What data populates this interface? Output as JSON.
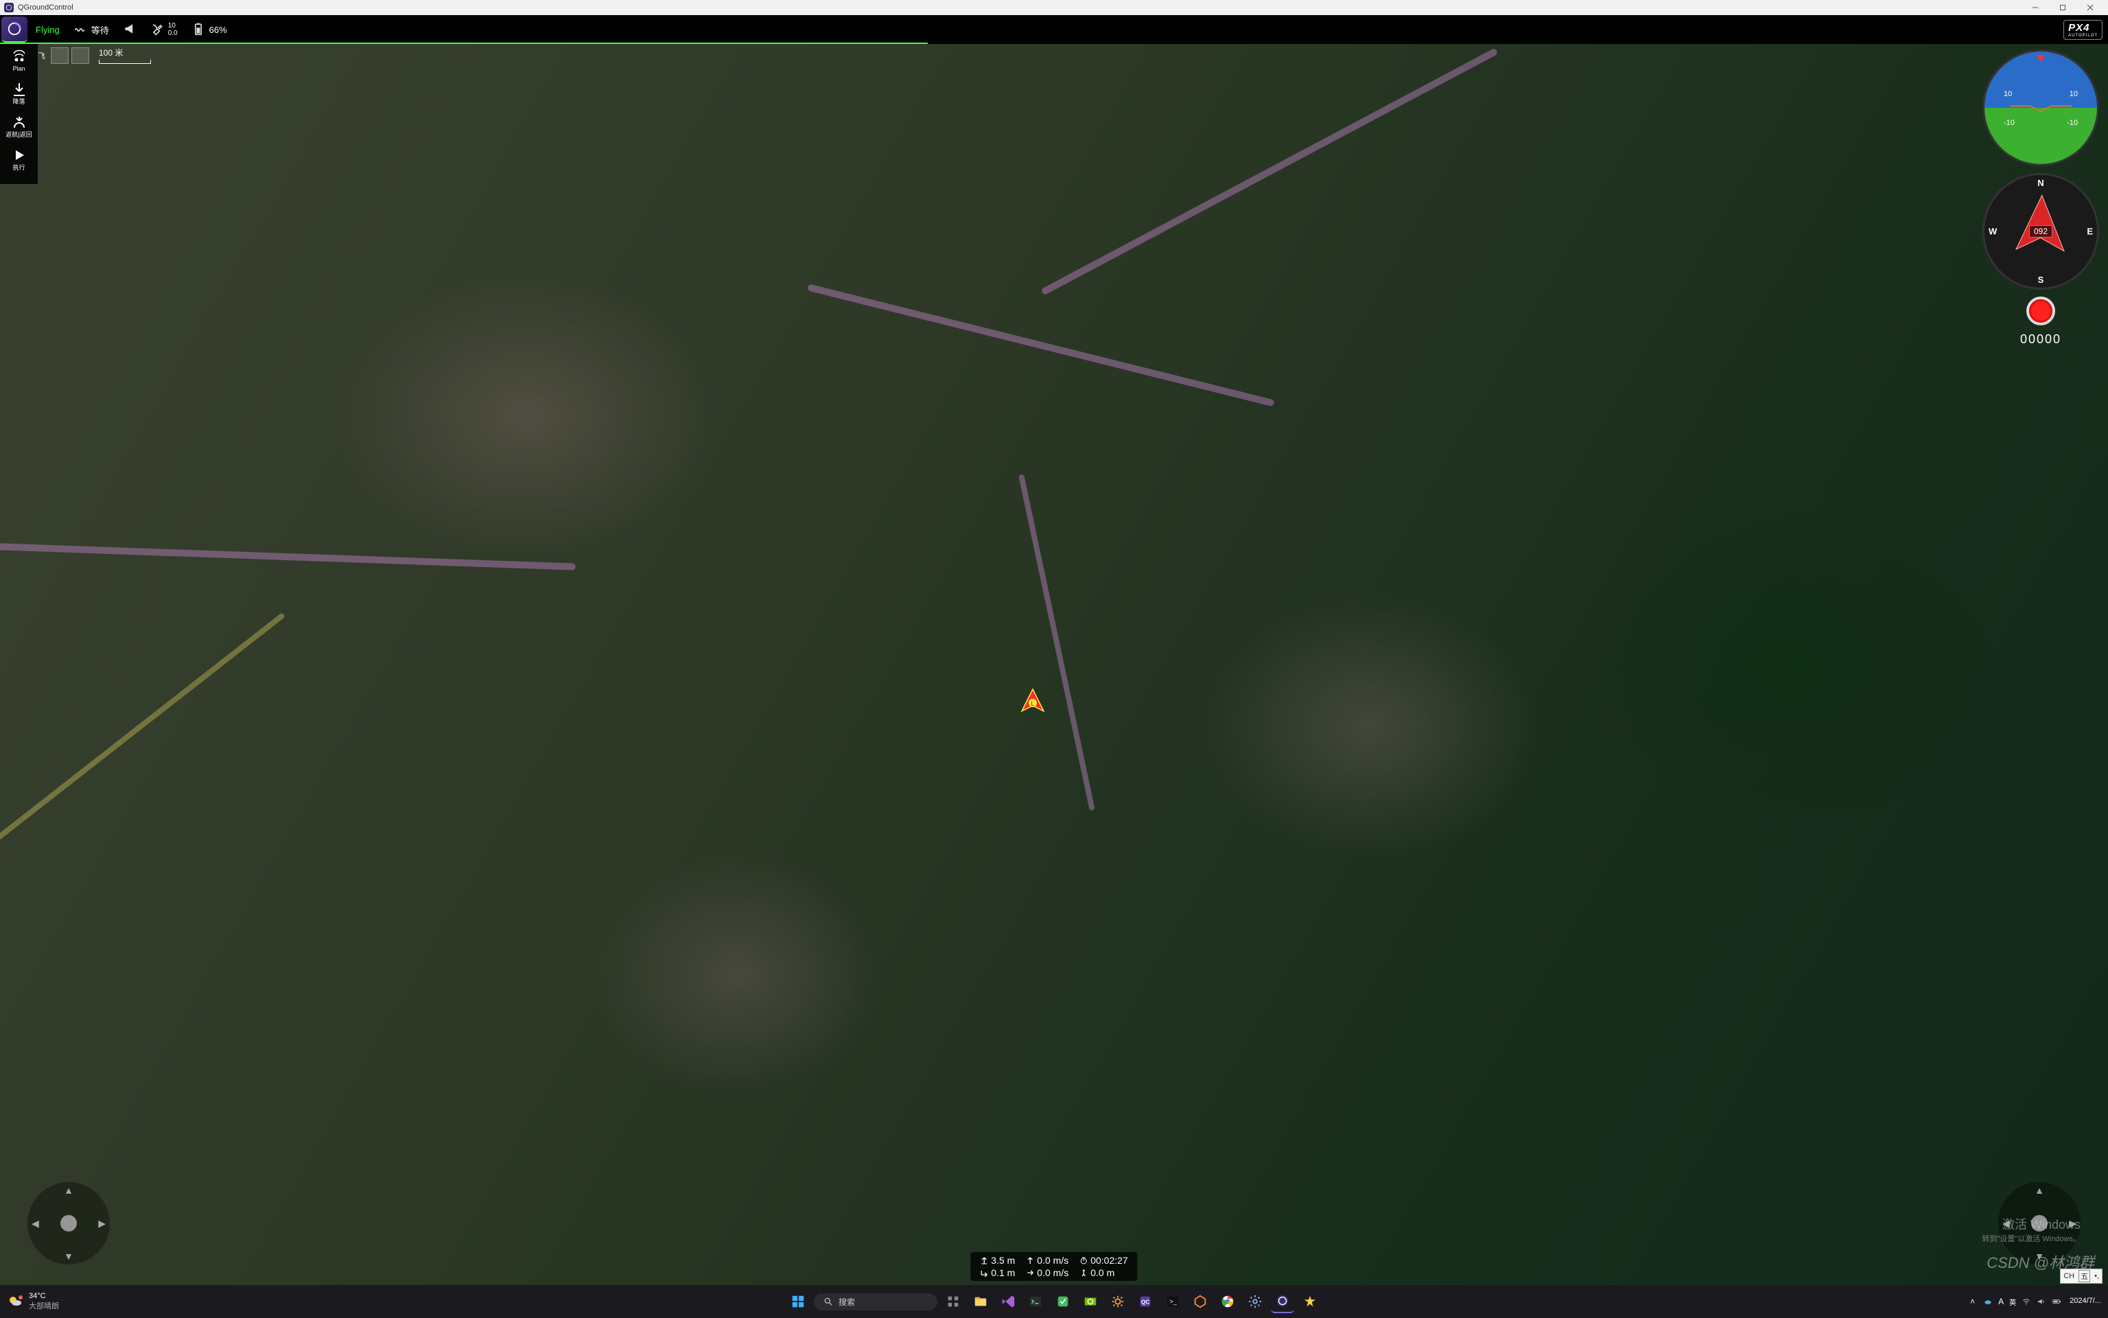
{
  "window": {
    "title": "QGroundControl"
  },
  "toolbar": {
    "mode": "Flying",
    "status": "等待",
    "satellites_top": "10",
    "satellites_bottom": "0.0",
    "battery_pct": "66%",
    "brand": "PX4",
    "brand_sub": "AUTOPILOT"
  },
  "scale": {
    "label": "100 米",
    "fly_label": "飞"
  },
  "left_tools": {
    "plan": "Plan",
    "land": "降落",
    "rtl": "返航|返回",
    "action": "执行"
  },
  "telemetry": {
    "alt": "3.5 m",
    "vspeed": "0.0 m/s",
    "time": "00:02:27",
    "dist": "0.1 m",
    "hspeed": "0.0 m/s",
    "hdg_dist": "0.0 m"
  },
  "compass": {
    "heading": "092",
    "n": "N",
    "e": "E",
    "s": "S",
    "w": "W"
  },
  "attitude": {
    "up10": "10",
    "dn10": "-10"
  },
  "recorder": {
    "counter": "00000"
  },
  "activate": {
    "line1": "激活 Windows",
    "line2": "转到\"设置\"以激活 Windows。"
  },
  "csdn": "CSDN @林鸿群",
  "ime": {
    "a": "CH",
    "b": "五",
    "c": "•,"
  },
  "taskbar": {
    "temp": "34°C",
    "weather": "大部晴朗",
    "search": "搜索",
    "time": "",
    "date": "2024/7/..."
  }
}
